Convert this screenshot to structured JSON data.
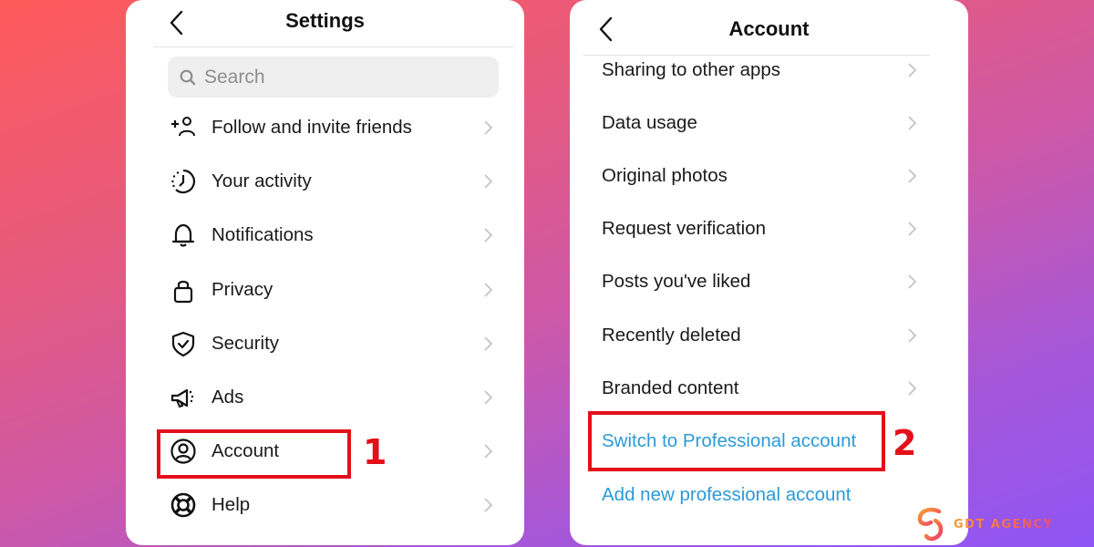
{
  "left_screen": {
    "title": "Settings",
    "search": {
      "placeholder": "Search",
      "value": ""
    },
    "items": [
      {
        "label": "Follow and invite friends",
        "icon": "add-person-icon"
      },
      {
        "label": "Your activity",
        "icon": "activity-clock-icon"
      },
      {
        "label": "Notifications",
        "icon": "bell-icon"
      },
      {
        "label": "Privacy",
        "icon": "lock-icon"
      },
      {
        "label": "Security",
        "icon": "shield-check-icon"
      },
      {
        "label": "Ads",
        "icon": "megaphone-icon"
      },
      {
        "label": "Account",
        "icon": "user-circle-icon"
      },
      {
        "label": "Help",
        "icon": "lifebuoy-icon"
      }
    ],
    "highlighted_item": "Account",
    "step_label": "1"
  },
  "right_screen": {
    "title": "Account",
    "items": [
      {
        "label": "Sharing to other apps"
      },
      {
        "label": "Data usage"
      },
      {
        "label": "Original photos"
      },
      {
        "label": "Request verification"
      },
      {
        "label": "Posts you've liked"
      },
      {
        "label": "Recently deleted"
      },
      {
        "label": "Branded content"
      }
    ],
    "links": [
      {
        "label": "Switch to Professional account"
      },
      {
        "label": "Add new professional account"
      }
    ],
    "highlighted_item": "Switch to Professional account",
    "step_label": "2"
  },
  "branding": {
    "name": "GDT AGENCY"
  },
  "colors": {
    "highlight_red": "#e3101c",
    "link_blue": "#2c9ad8",
    "text_dark": "#1a1a1a",
    "search_bg": "#efefef",
    "chevron_gray": "#c4c4c4"
  }
}
